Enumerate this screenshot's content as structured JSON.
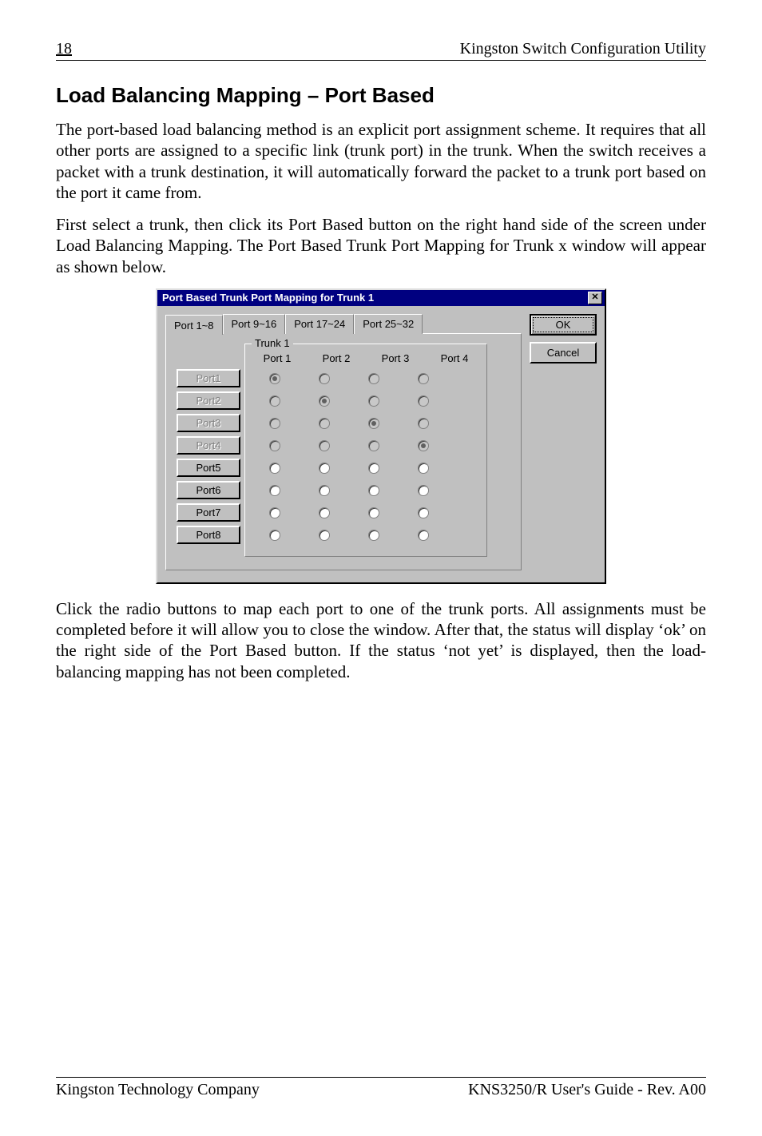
{
  "header": {
    "page_number": "18",
    "running_title": "Kingston Switch Configuration Utility"
  },
  "section": {
    "title": "Load Balancing Mapping – Port Based",
    "para1": "The port-based load balancing method is an explicit port assignment scheme. It requires that all other ports are assigned to a specific link (trunk port) in the trunk. When the switch receives a packet with a trunk destination, it will automatically forward the packet to a trunk port based on the port it came from.",
    "para2": "First select a trunk, then click its Port Based button on the right hand side of the screen under Load Balancing Mapping. The Port Based Trunk Port Mapping for Trunk x window will appear as shown below.",
    "para3": "Click the radio buttons to map each port to one of the trunk ports. All assignments must be completed before it will allow you to close the window. After that, the status will display ‘ok’ on the right side of the Port Based button. If the status ‘not yet’ is displayed, then the load-balancing mapping has not been completed."
  },
  "dialog": {
    "title": "Port Based Trunk Port Mapping for Trunk 1",
    "close_glyph": "✕",
    "tabs": [
      "Port 1~8",
      "Port 9~16",
      "Port 17~24",
      "Port 25~32"
    ],
    "active_tab_index": 0,
    "ok_label": "OK",
    "cancel_label": "Cancel",
    "group_label": "Trunk 1",
    "columns": [
      "Port 1",
      "Port 2",
      "Port 3",
      "Port 4"
    ],
    "rows": [
      {
        "label": "Port1",
        "enabled": false,
        "selected": 0
      },
      {
        "label": "Port2",
        "enabled": false,
        "selected": 1
      },
      {
        "label": "Port3",
        "enabled": false,
        "selected": 2
      },
      {
        "label": "Port4",
        "enabled": false,
        "selected": 3
      },
      {
        "label": "Port5",
        "enabled": true,
        "selected": -1
      },
      {
        "label": "Port6",
        "enabled": true,
        "selected": -1
      },
      {
        "label": "Port7",
        "enabled": true,
        "selected": -1
      },
      {
        "label": "Port8",
        "enabled": true,
        "selected": -1
      }
    ]
  },
  "footer": {
    "left": "Kingston Technology Company",
    "right": "KNS3250/R User's Guide - Rev. A00"
  }
}
